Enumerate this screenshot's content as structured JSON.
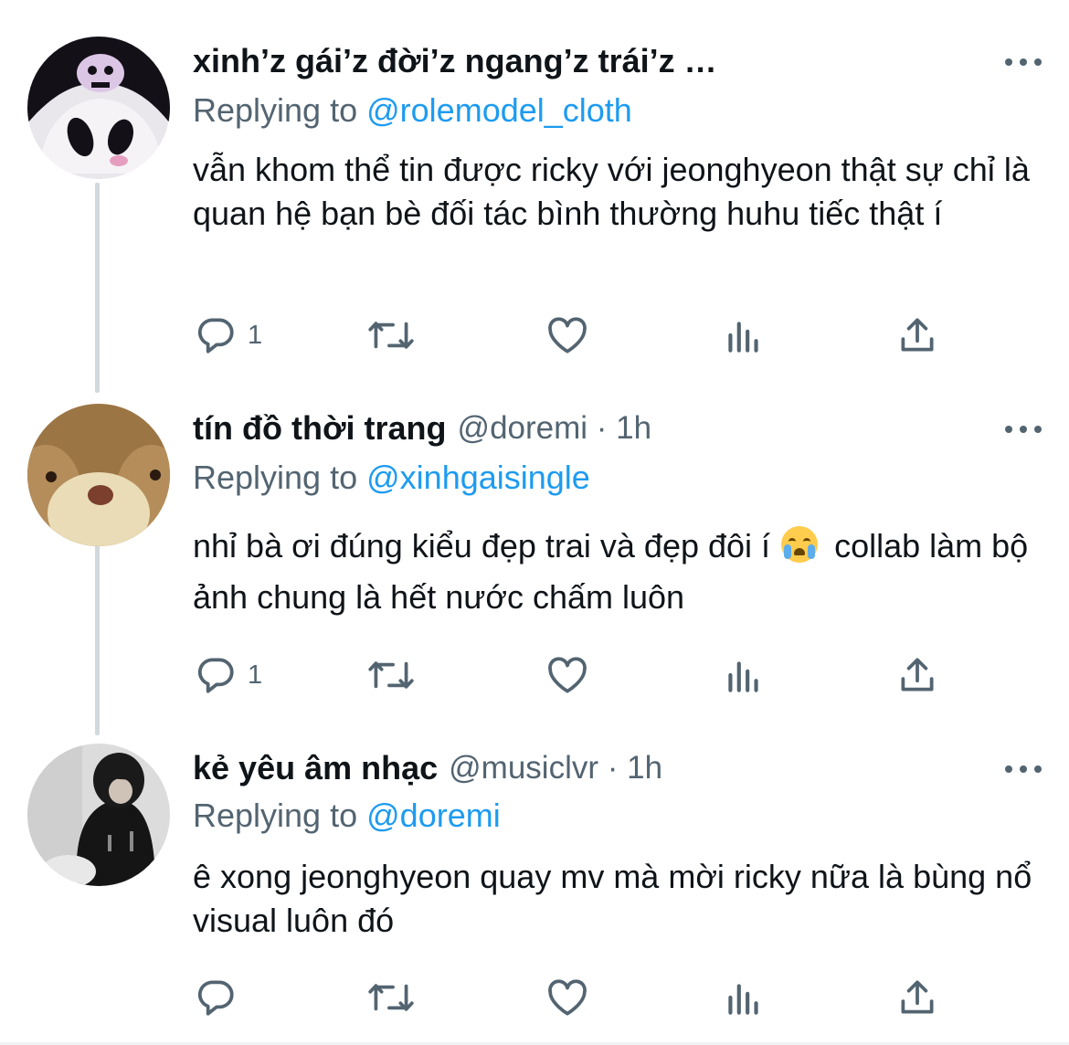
{
  "colors": {
    "link": "#1d9bf0",
    "secondary_text": "#536471",
    "primary_text": "#0f1419",
    "thread_line": "#cfd9de"
  },
  "tweets": [
    {
      "display_name": "xinh’z gái’z đời’z ngang’z trái’z …",
      "handle": "",
      "replying_label": "Replying to",
      "replying_to": "@rolemodel_cloth",
      "text": "vẫn khom thể tin được ricky với jeonghyeon thật sự chỉ là quan hệ bạn bè đối tác bình thường huhu tiếc thật í",
      "reply_count": "1",
      "icons": [
        "reply-icon",
        "retweet-icon",
        "like-icon",
        "analytics-icon",
        "share-icon",
        "more-icon"
      ]
    },
    {
      "display_name": "tín đồ thời trang",
      "handle": "@doremi · 1h",
      "replying_label": "Replying to",
      "replying_to": "@xinhgaisingle",
      "text_before_emoji": "nhỉ bà ơi đúng kiểu đẹp trai và đẹp đôi í",
      "emoji": "loudly-crying-face-emoji",
      "text_after_emoji": " collab làm bộ ảnh chung là hết nước chấm luôn",
      "reply_count": "1",
      "icons": [
        "reply-icon",
        "retweet-icon",
        "like-icon",
        "analytics-icon",
        "share-icon",
        "more-icon"
      ]
    },
    {
      "display_name": "kẻ yêu âm nhạc",
      "handle": "@musiclvr · 1h",
      "replying_label": "Replying to",
      "replying_to": "@doremi",
      "text": "ê xong jeonghyeon quay mv mà mời ricky nữa là bùng nổ visual luôn đó",
      "reply_count": "",
      "icons": [
        "reply-icon",
        "retweet-icon",
        "like-icon",
        "analytics-icon",
        "share-icon",
        "more-icon"
      ]
    }
  ]
}
